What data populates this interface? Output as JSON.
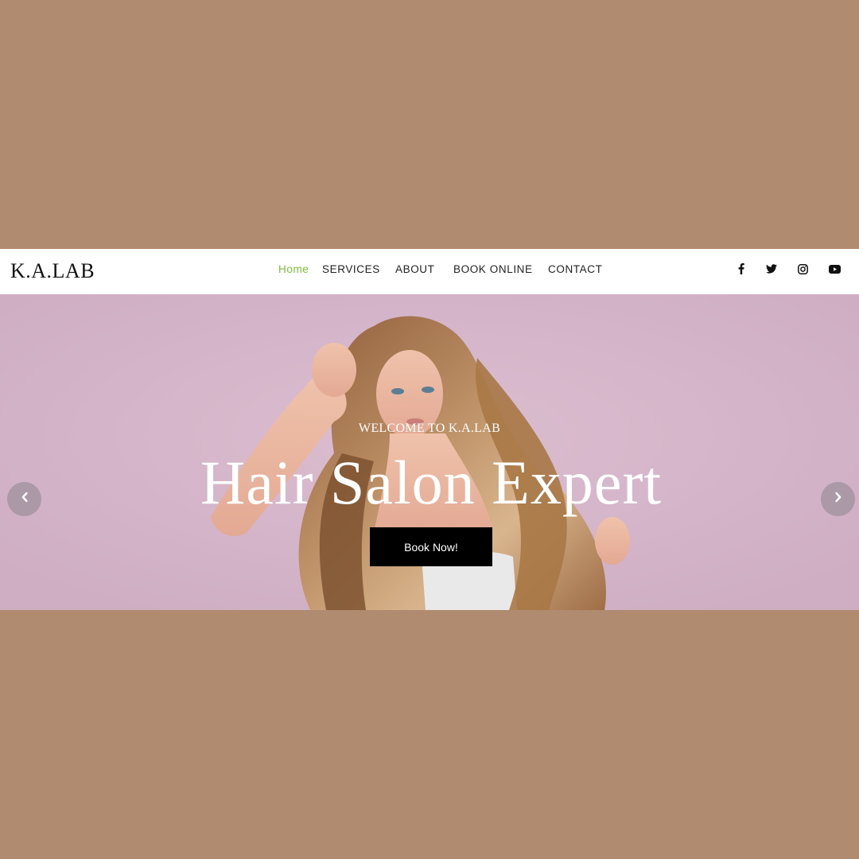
{
  "header": {
    "logo": "K.A.LAB",
    "nav": [
      {
        "label": "Home",
        "active": true
      },
      {
        "label": "SERVICES"
      },
      {
        "label": "ABOUT"
      },
      {
        "label": "BOOK ONLINE"
      },
      {
        "label": "CONTACT"
      }
    ],
    "social": [
      "facebook-icon",
      "twitter-icon",
      "instagram-icon",
      "youtube-icon"
    ]
  },
  "hero": {
    "subtitle": "WELCOME TO K.A.LAB",
    "title": "Hair Salon Expert",
    "button": "Book Now!",
    "arrows": [
      "chevron-left-icon",
      "chevron-right-icon"
    ]
  },
  "colors": {
    "background": "#b08b70",
    "nav_active": "#7bbf3a",
    "button": "#000000",
    "hero_pink": "#d2b2c6"
  }
}
